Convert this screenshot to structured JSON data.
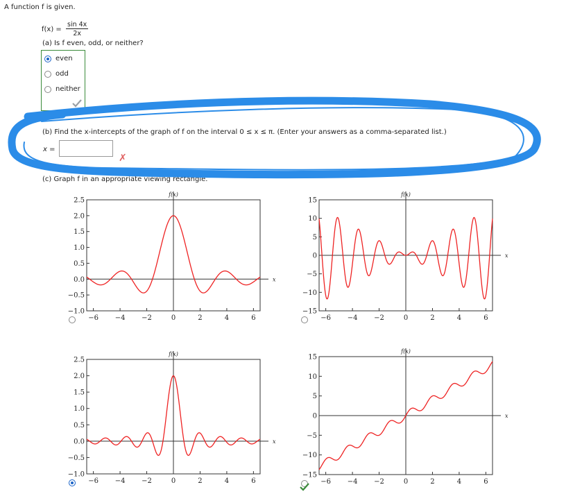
{
  "intro": "A function f is given.",
  "function": {
    "lhs": "f(x) =",
    "numerator": "sin 4x",
    "denominator": "2x"
  },
  "part_a": {
    "question": "(a) Is f even, odd, or neither?",
    "options": [
      {
        "label": "even",
        "selected": true
      },
      {
        "label": "odd",
        "selected": false
      },
      {
        "label": "neither",
        "selected": false
      }
    ]
  },
  "part_b": {
    "question": "(b) Find the x-intercepts of the graph of f on the interval 0 ≤ x ≤ π. (Enter your answers as a comma-separated list.)",
    "x_label": "x =",
    "answer_value": ""
  },
  "part_c": {
    "question": "(c) Graph f in an appropriate viewing rectangle."
  },
  "colors": {
    "curve": "#ee2222",
    "correct_check": "#3a8a3a",
    "wrong_x": "#e06060",
    "scribble": "#2b8ce8"
  },
  "icons": {
    "check": "check-icon",
    "wrong": "x-mark-icon"
  },
  "chart_data": [
    {
      "type": "line",
      "function": "sin(4x)/(2x)",
      "title": "f(x)",
      "xlabel": "x",
      "ylabel": "f(x)",
      "xlim": [
        -6.5,
        6.5
      ],
      "ylim": [
        -1.0,
        2.5
      ],
      "xticks": [
        "-6",
        "-4",
        "-2",
        "0",
        "2",
        "4",
        "6"
      ],
      "yticks": [
        "2.5",
        "2.0",
        "1.5",
        "1.0",
        "0.5",
        "0.0",
        "-0.5",
        "-1.0"
      ],
      "x_scale": 0.5,
      "selected": false
    },
    {
      "type": "line",
      "function": "2x·sin(4x)",
      "title": "f(x)",
      "xlabel": "x",
      "ylabel": "f(x)",
      "xlim": [
        -6.5,
        6.5
      ],
      "ylim": [
        -15,
        15
      ],
      "xticks": [
        "-6",
        "-4",
        "-2",
        "0",
        "2",
        "4",
        "6"
      ],
      "yticks": [
        "15",
        "10",
        "5",
        "0",
        "-5",
        "-10",
        "-15"
      ],
      "selected": false
    },
    {
      "type": "line",
      "function": "sin(4x)/(2x)",
      "title": "f(x)",
      "xlabel": "x",
      "ylabel": "f(x)",
      "xlim": [
        -6.5,
        6.5
      ],
      "ylim": [
        -1.0,
        2.5
      ],
      "xticks": [
        "-6",
        "-4",
        "-2",
        "0",
        "2",
        "4",
        "6"
      ],
      "yticks": [
        "2.5",
        "2.0",
        "1.5",
        "1.0",
        "0.5",
        "0.0",
        "-0.5",
        "-1.0"
      ],
      "x_scale": 1,
      "selected": true
    },
    {
      "type": "line",
      "function": "2x + sin(4x)",
      "title": "f(x)",
      "xlabel": "x",
      "ylabel": "f(x)",
      "xlim": [
        -6.5,
        6.5
      ],
      "ylim": [
        -15,
        15
      ],
      "xticks": [
        "-6",
        "-4",
        "-2",
        "0",
        "2",
        "4",
        "6"
      ],
      "yticks": [
        "15",
        "10",
        "5",
        "0",
        "-5",
        "-10",
        "-15"
      ],
      "selected": false
    }
  ]
}
